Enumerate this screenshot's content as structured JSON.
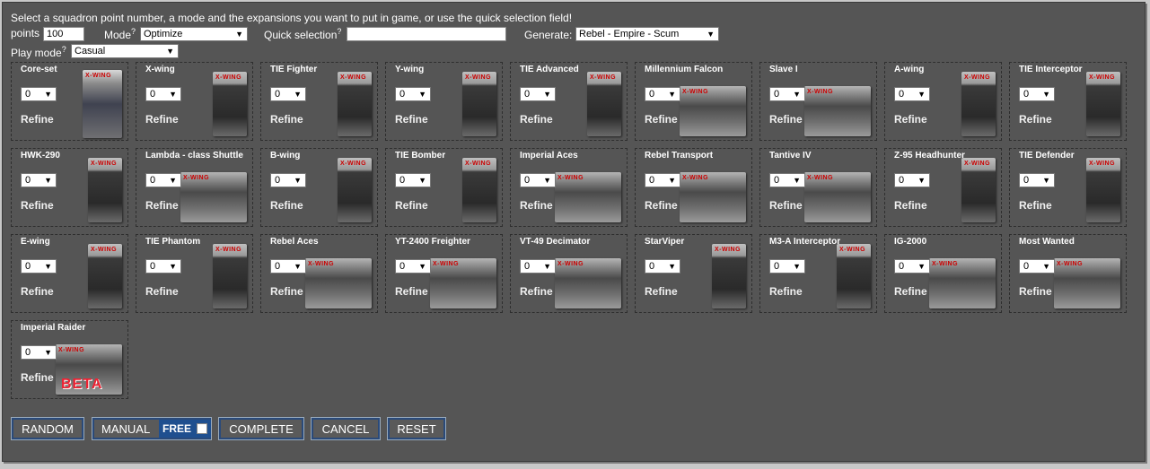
{
  "instructions": "Select a squadron point number, a mode and the expansions you want to put in game, or use the quick selection field!",
  "points": {
    "label": "points",
    "value": "100"
  },
  "mode": {
    "label": "Mode",
    "help": "?",
    "value": "Optimize"
  },
  "quick_selection": {
    "label": "Quick selection",
    "help": "?",
    "value": ""
  },
  "generate": {
    "label": "Generate:",
    "value": "Rebel - Empire - Scum"
  },
  "play_mode": {
    "label": "Play mode",
    "help": "?",
    "value": "Casual"
  },
  "refine_label": "Refine",
  "logo_text": "X-WING",
  "beta_text": "BETA",
  "expansions": [
    {
      "name": "Core-set",
      "qty": "0",
      "box": "core"
    },
    {
      "name": "X-wing",
      "qty": "0",
      "box": "tall"
    },
    {
      "name": "TIE Fighter",
      "qty": "0",
      "box": "tall"
    },
    {
      "name": "Y-wing",
      "qty": "0",
      "box": "tall"
    },
    {
      "name": "TIE Advanced",
      "qty": "0",
      "box": "tall"
    },
    {
      "name": "Millennium Falcon",
      "qty": "0",
      "box": "wide"
    },
    {
      "name": "Slave I",
      "qty": "0",
      "box": "wide"
    },
    {
      "name": "A-wing",
      "qty": "0",
      "box": "tall"
    },
    {
      "name": "TIE Interceptor",
      "qty": "0",
      "box": "tall"
    },
    {
      "name": "HWK-290",
      "qty": "0",
      "box": "tall"
    },
    {
      "name": "Lambda - class Shuttle",
      "qty": "0",
      "box": "wide"
    },
    {
      "name": "B-wing",
      "qty": "0",
      "box": "tall"
    },
    {
      "name": "TIE Bomber",
      "qty": "0",
      "box": "tall"
    },
    {
      "name": "Imperial Aces",
      "qty": "0",
      "box": "wide"
    },
    {
      "name": "Rebel Transport",
      "qty": "0",
      "box": "wide"
    },
    {
      "name": "Tantive IV",
      "qty": "0",
      "box": "wide"
    },
    {
      "name": "Z-95 Headhunter",
      "qty": "0",
      "box": "tall"
    },
    {
      "name": "TIE Defender",
      "qty": "0",
      "box": "tall"
    },
    {
      "name": "E-wing",
      "qty": "0",
      "box": "tall"
    },
    {
      "name": "TIE Phantom",
      "qty": "0",
      "box": "tall"
    },
    {
      "name": "Rebel Aces",
      "qty": "0",
      "box": "wide"
    },
    {
      "name": "YT-2400 Freighter",
      "qty": "0",
      "box": "wide"
    },
    {
      "name": "VT-49 Decimator",
      "qty": "0",
      "box": "wide"
    },
    {
      "name": "StarViper",
      "qty": "0",
      "box": "tall"
    },
    {
      "name": "M3-A Interceptor",
      "qty": "0",
      "box": "tall"
    },
    {
      "name": "IG-2000",
      "qty": "0",
      "box": "wide"
    },
    {
      "name": "Most Wanted",
      "qty": "0",
      "box": "wide"
    },
    {
      "name": "Imperial Raider",
      "qty": "0",
      "box": "beta"
    }
  ],
  "buttons": {
    "random": "RANDOM",
    "manual": "MANUAL",
    "free": "FREE",
    "complete": "COMPLETE",
    "cancel": "CANCEL",
    "reset": "RESET"
  }
}
